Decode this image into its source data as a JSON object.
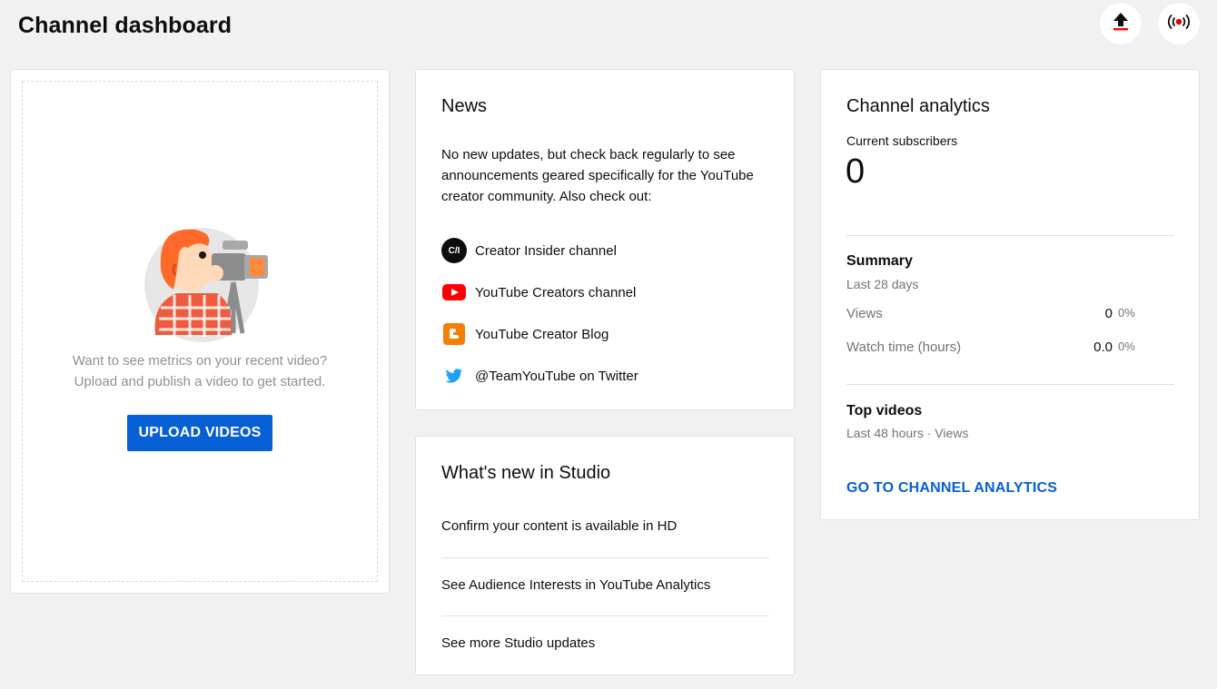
{
  "header": {
    "title": "Channel dashboard",
    "upload_icon": "upload-icon",
    "live_icon": "go-live-icon",
    "accent_color": "#065fd4",
    "brand_red": "#ff0000"
  },
  "upload_card": {
    "illustration": "camera-operator-illustration",
    "line1": "Want to see metrics on your recent video?",
    "line2": "Upload and publish a video to get started.",
    "button_label": "UPLOAD VIDEOS"
  },
  "news": {
    "title": "News",
    "body": "No new updates, but check back regularly to see announcements geared specifically for the YouTube creator community. Also check out:",
    "links": [
      {
        "label": "Creator Insider channel",
        "icon": "creator-insider-icon",
        "icon_text": "C/I"
      },
      {
        "label": "YouTube Creators channel",
        "icon": "youtube-icon"
      },
      {
        "label": "YouTube Creator Blog",
        "icon": "blogger-icon"
      },
      {
        "label": "@TeamYouTube on Twitter",
        "icon": "twitter-icon"
      }
    ]
  },
  "whats_new": {
    "title": "What's new in Studio",
    "items": [
      "Confirm your content is available in HD",
      "See Audience Interests in YouTube Analytics",
      "See more Studio updates"
    ]
  },
  "analytics": {
    "title": "Channel analytics",
    "subscribers_label": "Current subscribers",
    "subscribers_value": "0",
    "summary_title": "Summary",
    "summary_period": "Last 28 days",
    "metrics": [
      {
        "label": "Views",
        "value": "0",
        "change": "0%"
      },
      {
        "label": "Watch time (hours)",
        "value": "0.0",
        "change": "0%"
      }
    ],
    "top_videos_title": "Top videos",
    "top_videos_period": "Last 48 hours · Views",
    "link_label": "GO TO CHANNEL ANALYTICS"
  }
}
